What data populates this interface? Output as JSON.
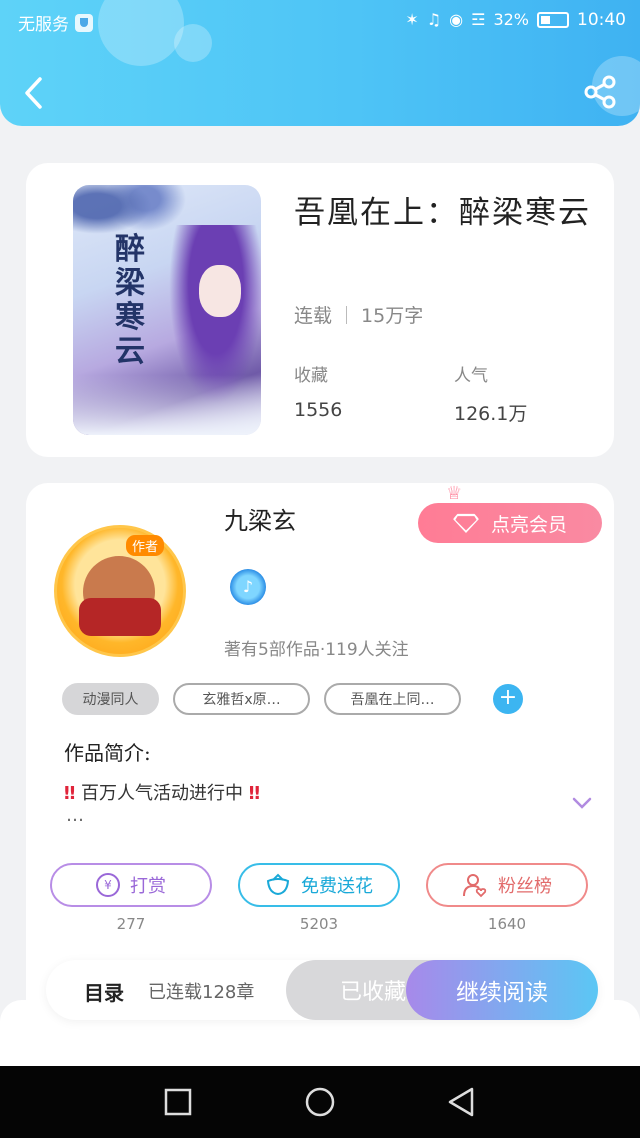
{
  "status_bar": {
    "carrier": "无服务",
    "battery": "32%",
    "time": "10:40"
  },
  "book": {
    "title": "吾凰在上：醉梁寒云",
    "status": "连载",
    "word_count": "15万字",
    "favorites_label": "收藏",
    "favorites_value": "1556",
    "popularity_label": "人气",
    "popularity_value": "126.1万",
    "cover_art_title": "醉梁寒云"
  },
  "author": {
    "name": "九梁玄",
    "tag": "作者",
    "stats": "著有5部作品·119人关注",
    "vip_button": "点亮会员"
  },
  "tags": [
    "动漫同人",
    "玄雅哲x原…",
    "吾凰在上同…"
  ],
  "intro": {
    "label": "作品简介:",
    "text": "百万人气活动进行中",
    "more": "…"
  },
  "actions": [
    {
      "label": "打赏",
      "count": "277",
      "icon": "yen-icon"
    },
    {
      "label": "免费送花",
      "count": "5203",
      "icon": "flower-icon"
    },
    {
      "label": "粉丝榜",
      "count": "1640",
      "icon": "fans-icon"
    }
  ],
  "bottom_bar": {
    "toc": "目录",
    "chapters": "已连载128章",
    "collected": "已收藏",
    "continue": "继续阅读"
  },
  "colors": {
    "header_blue": "#4ec4f6",
    "vip_pink": "#ff7c95",
    "accent_blue": "#3cb5f1"
  }
}
